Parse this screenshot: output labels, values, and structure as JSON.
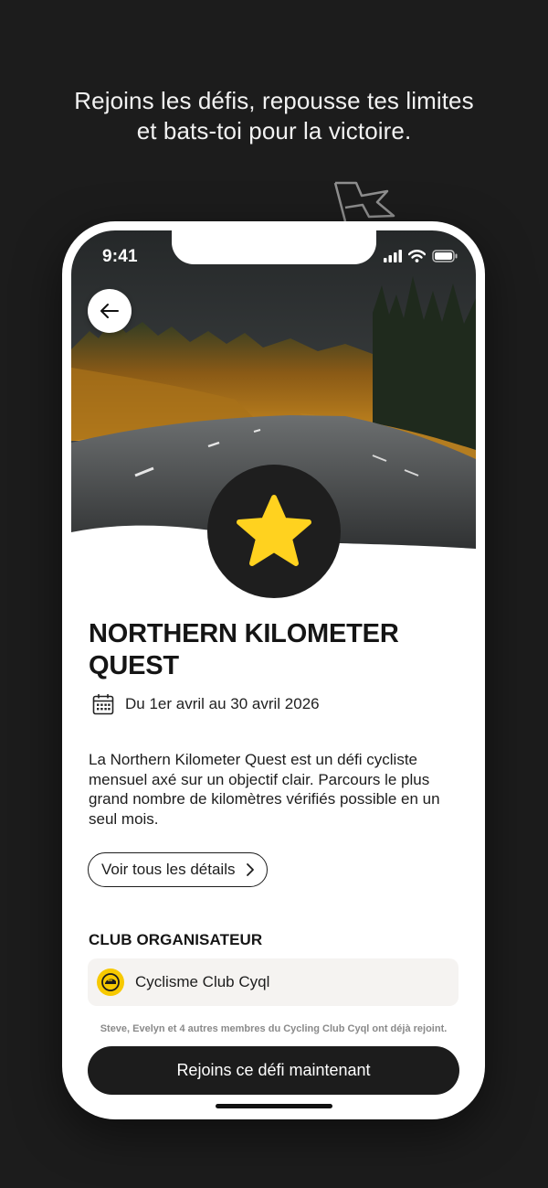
{
  "tagline": {
    "line1": "Rejoins les défis, repousse tes limites",
    "line2": "et bats-toi pour la victoire."
  },
  "status_bar": {
    "time": "9:41",
    "icons": [
      "signal-icon",
      "wifi-icon",
      "battery-icon"
    ]
  },
  "hero": {
    "image": "autumn-forest-road-photo",
    "back_icon": "arrow-left-icon",
    "badge_icon": "star-icon",
    "badge_color": "#FFD21F"
  },
  "challenge": {
    "title": "NORTHERN KILOMETER QUEST",
    "dates_icon": "calendar-icon",
    "dates": "Du 1er avril au 30 avril 2026",
    "description": "La Northern Kilometer Quest est un défi cycliste mensuel axé sur un objectif clair. Parcours le plus grand nombre de kilomètres vérifiés possible en un seul mois.",
    "details_button": "Voir tous les détails"
  },
  "organizer": {
    "section_title": "CLUB ORGANISATEUR",
    "club_name": "Cyclisme Club Cyql",
    "club_logo_color": "#F7C900"
  },
  "members_note": "Steve, Evelyn et 4 autres membres du Cycling Club Cyql ont déjà rejoint.",
  "join_button": "Rejoins ce défi maintenant",
  "colors": {
    "background": "#1C1C1C",
    "accent": "#FFD21F",
    "button": "#1C1C1C"
  }
}
